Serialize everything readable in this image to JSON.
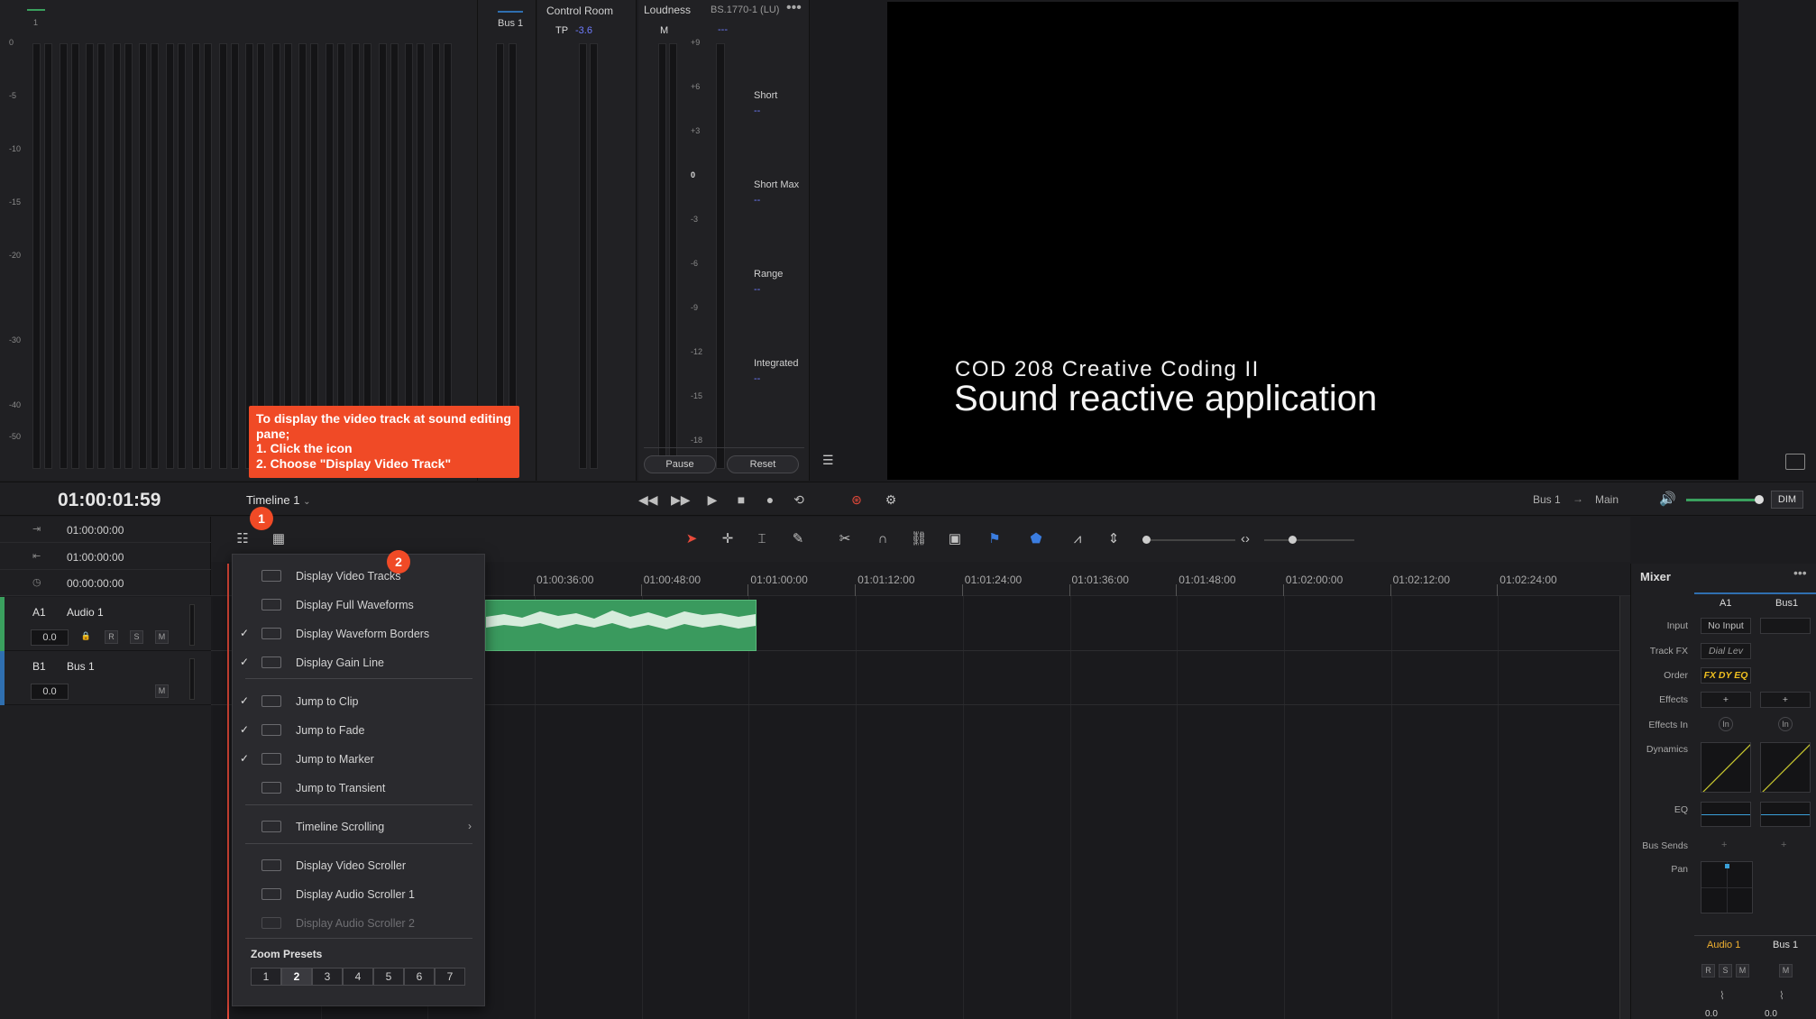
{
  "meters": {
    "scale": [
      "0",
      "-5",
      "-10",
      "-15",
      "-20",
      "-30",
      "-40",
      "-50"
    ],
    "channel_number": "1",
    "bus_label": "Bus 1"
  },
  "control_room": {
    "title": "Control Room",
    "tp_label": "TP",
    "tp_value": "-3.6"
  },
  "loudness": {
    "title": "Loudness",
    "standard": "BS.1770-1 (LU)",
    "m_label": "M",
    "m_value": "---",
    "scale": [
      "+9",
      "+6",
      "+3",
      "0",
      "-3",
      "-6",
      "-9",
      "-12",
      "-15",
      "-18"
    ],
    "stats": [
      {
        "label": "Short",
        "value": "--"
      },
      {
        "label": "Short Max",
        "value": "--"
      },
      {
        "label": "Range",
        "value": "--"
      },
      {
        "label": "Integrated",
        "value": "--"
      }
    ],
    "pause_label": "Pause",
    "reset_label": "Reset"
  },
  "tooltip": {
    "line1": "To display the video track at sound editing pane;",
    "line2": "1. Click the icon",
    "line3": "2. Choose \"Display Video Track\""
  },
  "viewer": {
    "subtitle": "COD 208 Creative Coding II",
    "title": "Sound reactive application"
  },
  "transport": {
    "timecode": "01:00:01:59",
    "timeline_name": "Timeline 1",
    "route_from": "Bus 1",
    "route_to": "Main",
    "dim_label": "DIM"
  },
  "timecodes": [
    "01:00:00:00",
    "01:00:00:00",
    "00:00:00:00"
  ],
  "tracks": [
    {
      "id": "A1",
      "name": "Audio 1",
      "volume": "0.0",
      "color": "#3aa05e"
    },
    {
      "id": "B1",
      "name": "Bus 1",
      "volume": "0.0",
      "color": "#2f6fb0"
    }
  ],
  "ruler": [
    "01:00:36:00",
    "01:00:48:00",
    "01:01:00:00",
    "01:01:12:00",
    "01:01:24:00",
    "01:01:36:00",
    "01:01:48:00",
    "01:02:00:00",
    "01:02:12:00",
    "01:02:24:00"
  ],
  "badges": {
    "one": "1",
    "two": "2"
  },
  "menu": {
    "items": [
      {
        "label": "Display Video Tracks",
        "checked": false
      },
      {
        "label": "Display Full Waveforms",
        "checked": false
      },
      {
        "label": "Display Waveform Borders",
        "checked": true
      },
      {
        "label": "Display Gain Line",
        "checked": true
      },
      {
        "label": "Jump to Clip",
        "checked": true
      },
      {
        "label": "Jump to Fade",
        "checked": true
      },
      {
        "label": "Jump to Marker",
        "checked": true
      },
      {
        "label": "Jump to Transient",
        "checked": false
      },
      {
        "label": "Timeline Scrolling",
        "checked": false
      },
      {
        "label": "Display Video Scroller",
        "checked": false
      },
      {
        "label": "Display Audio Scroller 1",
        "checked": false
      },
      {
        "label": "Display Audio Scroller 2",
        "checked": false
      }
    ],
    "zoom_presets_label": "Zoom Presets",
    "zoom_presets": [
      "1",
      "2",
      "3",
      "4",
      "5",
      "6",
      "7"
    ],
    "zoom_selected": "2"
  },
  "mixer": {
    "title": "Mixer",
    "col_a1": "A1",
    "col_bus1": "Bus1",
    "rows": [
      "Input",
      "Track FX",
      "Order",
      "Effects",
      "Effects In",
      "Dynamics",
      "EQ",
      "Bus Sends",
      "Pan"
    ],
    "input_value": "No Input",
    "track_fx_value": "Dial Lev",
    "order_value": "FX DY EQ",
    "plus": "+",
    "in_label": "In",
    "strip_audio1": "Audio 1",
    "strip_bus1": "Bus 1",
    "r": "R",
    "s": "S",
    "m": "M",
    "fader_a1": "0.0",
    "fader_bus1": "0.0"
  },
  "colors": {
    "accent": "#f04a26",
    "clip": "#3a9a5e",
    "playhead": "#e74a3a",
    "loud_value": "#6f7dff"
  }
}
